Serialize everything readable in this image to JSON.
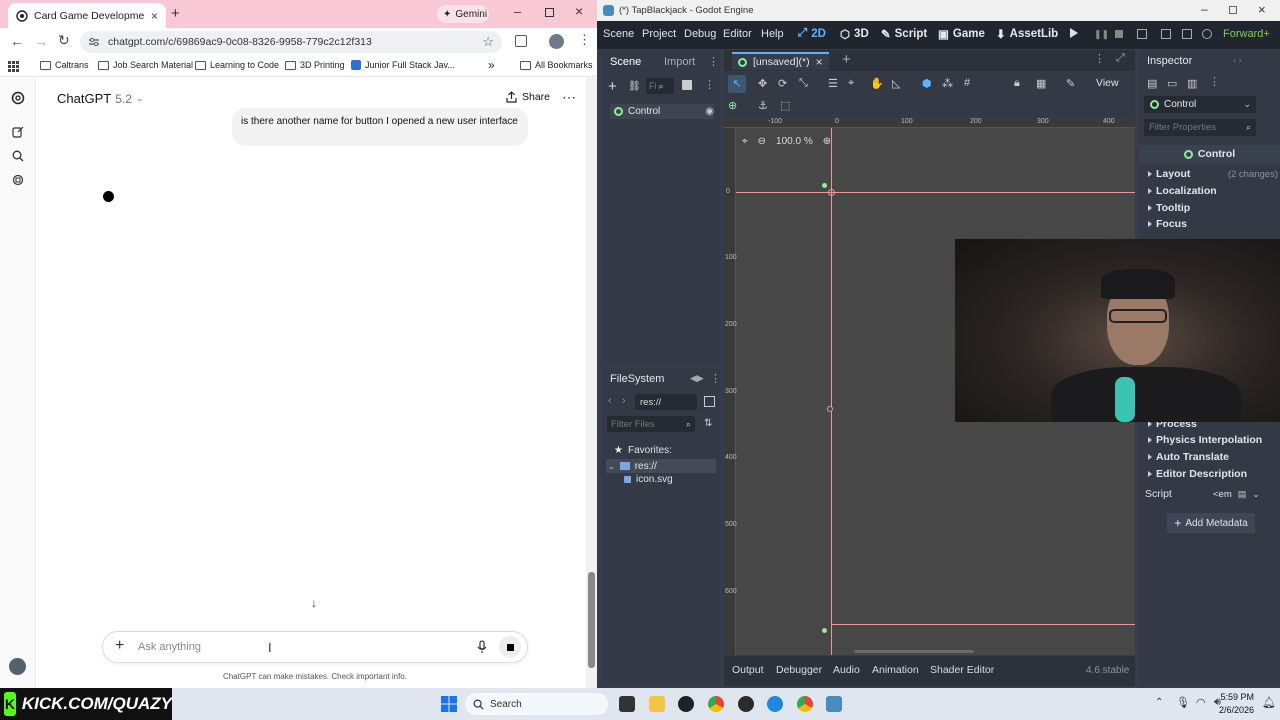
{
  "chrome": {
    "tab_title": "Card Game Development Guid",
    "new_tab_symbol": "+",
    "gemini_label": "Gemini",
    "url": "chatgpt.com/c/69869ac9-0c08-8326-9958-779c2c12f313",
    "bookmarks": [
      {
        "label": "Caltrans",
        "icon": "folder-icon"
      },
      {
        "label": "Job Search Material",
        "icon": "folder-icon"
      },
      {
        "label": "Learning to Code",
        "icon": "folder-icon"
      },
      {
        "label": "3D Printing",
        "icon": "folder-icon"
      },
      {
        "label": "Junior Full Stack Jav...",
        "icon": "page-icon"
      }
    ],
    "bookmarks_overflow": "»",
    "all_bookmarks": "All Bookmarks"
  },
  "chatgpt": {
    "model_name": "ChatGPT",
    "model_version": "5.2",
    "share_label": "Share",
    "user_message": "is there another name for button I opened a new user interface",
    "composer_placeholder": "Ask anything",
    "disclaimer": "ChatGPT can make mistakes. Check important info."
  },
  "godot": {
    "window_title": "(*) TapBlackjack - Godot Engine",
    "menu": [
      "Scene",
      "Project",
      "Debug",
      "Editor",
      "Help"
    ],
    "modes": [
      {
        "label": "2D",
        "active": true
      },
      {
        "label": "3D",
        "active": false
      },
      {
        "label": "Script",
        "active": false
      },
      {
        "label": "Game",
        "active": false
      },
      {
        "label": "AssetLib",
        "active": false
      }
    ],
    "renderer": "Forward+",
    "scene_dock": {
      "tabs": [
        "Scene",
        "Import"
      ],
      "filter_placeholder": "Fi",
      "root_node": "Control"
    },
    "editor_tab": "[unsaved](*)",
    "viewport": {
      "zoom": "100.0 %",
      "view_label": "View",
      "ruler_top": [
        "-100",
        "0",
        "100",
        "200",
        "300",
        "400"
      ],
      "ruler_left": [
        "0",
        "100",
        "200",
        "300",
        "400",
        "500",
        "600"
      ]
    },
    "filesystem": {
      "title": "FileSystem",
      "path": "res://",
      "filter_placeholder": "Filter Files",
      "favorites_label": "Favorites:",
      "root_folder": "res://",
      "files": [
        "icon.svg"
      ]
    },
    "inspector": {
      "title": "Inspector",
      "node_selector": "Control",
      "filter_placeholder": "Filter Properties",
      "class_header": "Control",
      "sections_top": [
        {
          "label": "Layout",
          "note": "(2 changes)"
        },
        {
          "label": "Localization",
          "note": ""
        },
        {
          "label": "Tooltip",
          "note": ""
        },
        {
          "label": "Focus",
          "note": ""
        }
      ],
      "sections_bottom": [
        "Process",
        "Physics Interpolation",
        "Auto Translate",
        "Editor Description"
      ],
      "script_label": "Script",
      "script_value": "<em",
      "add_metadata": "Add Metadata"
    },
    "bottom_tabs": [
      "Output",
      "Debugger",
      "Audio",
      "Animation",
      "Shader Editor"
    ],
    "version": "4.6.stable"
  },
  "taskbar": {
    "overlay_text": "KICK.COM/QUAZY",
    "search_label": "Search",
    "time": "5:59 PM",
    "date": "2/6/2026"
  },
  "colors": {
    "chrome_tab_strip": "#f8c8d4",
    "godot_bg": "#363d4a",
    "godot_menu": "#21262e",
    "godot_accent": "#5cb3ff",
    "kick_green": "#53fc18",
    "viewport_bg": "#474747"
  }
}
